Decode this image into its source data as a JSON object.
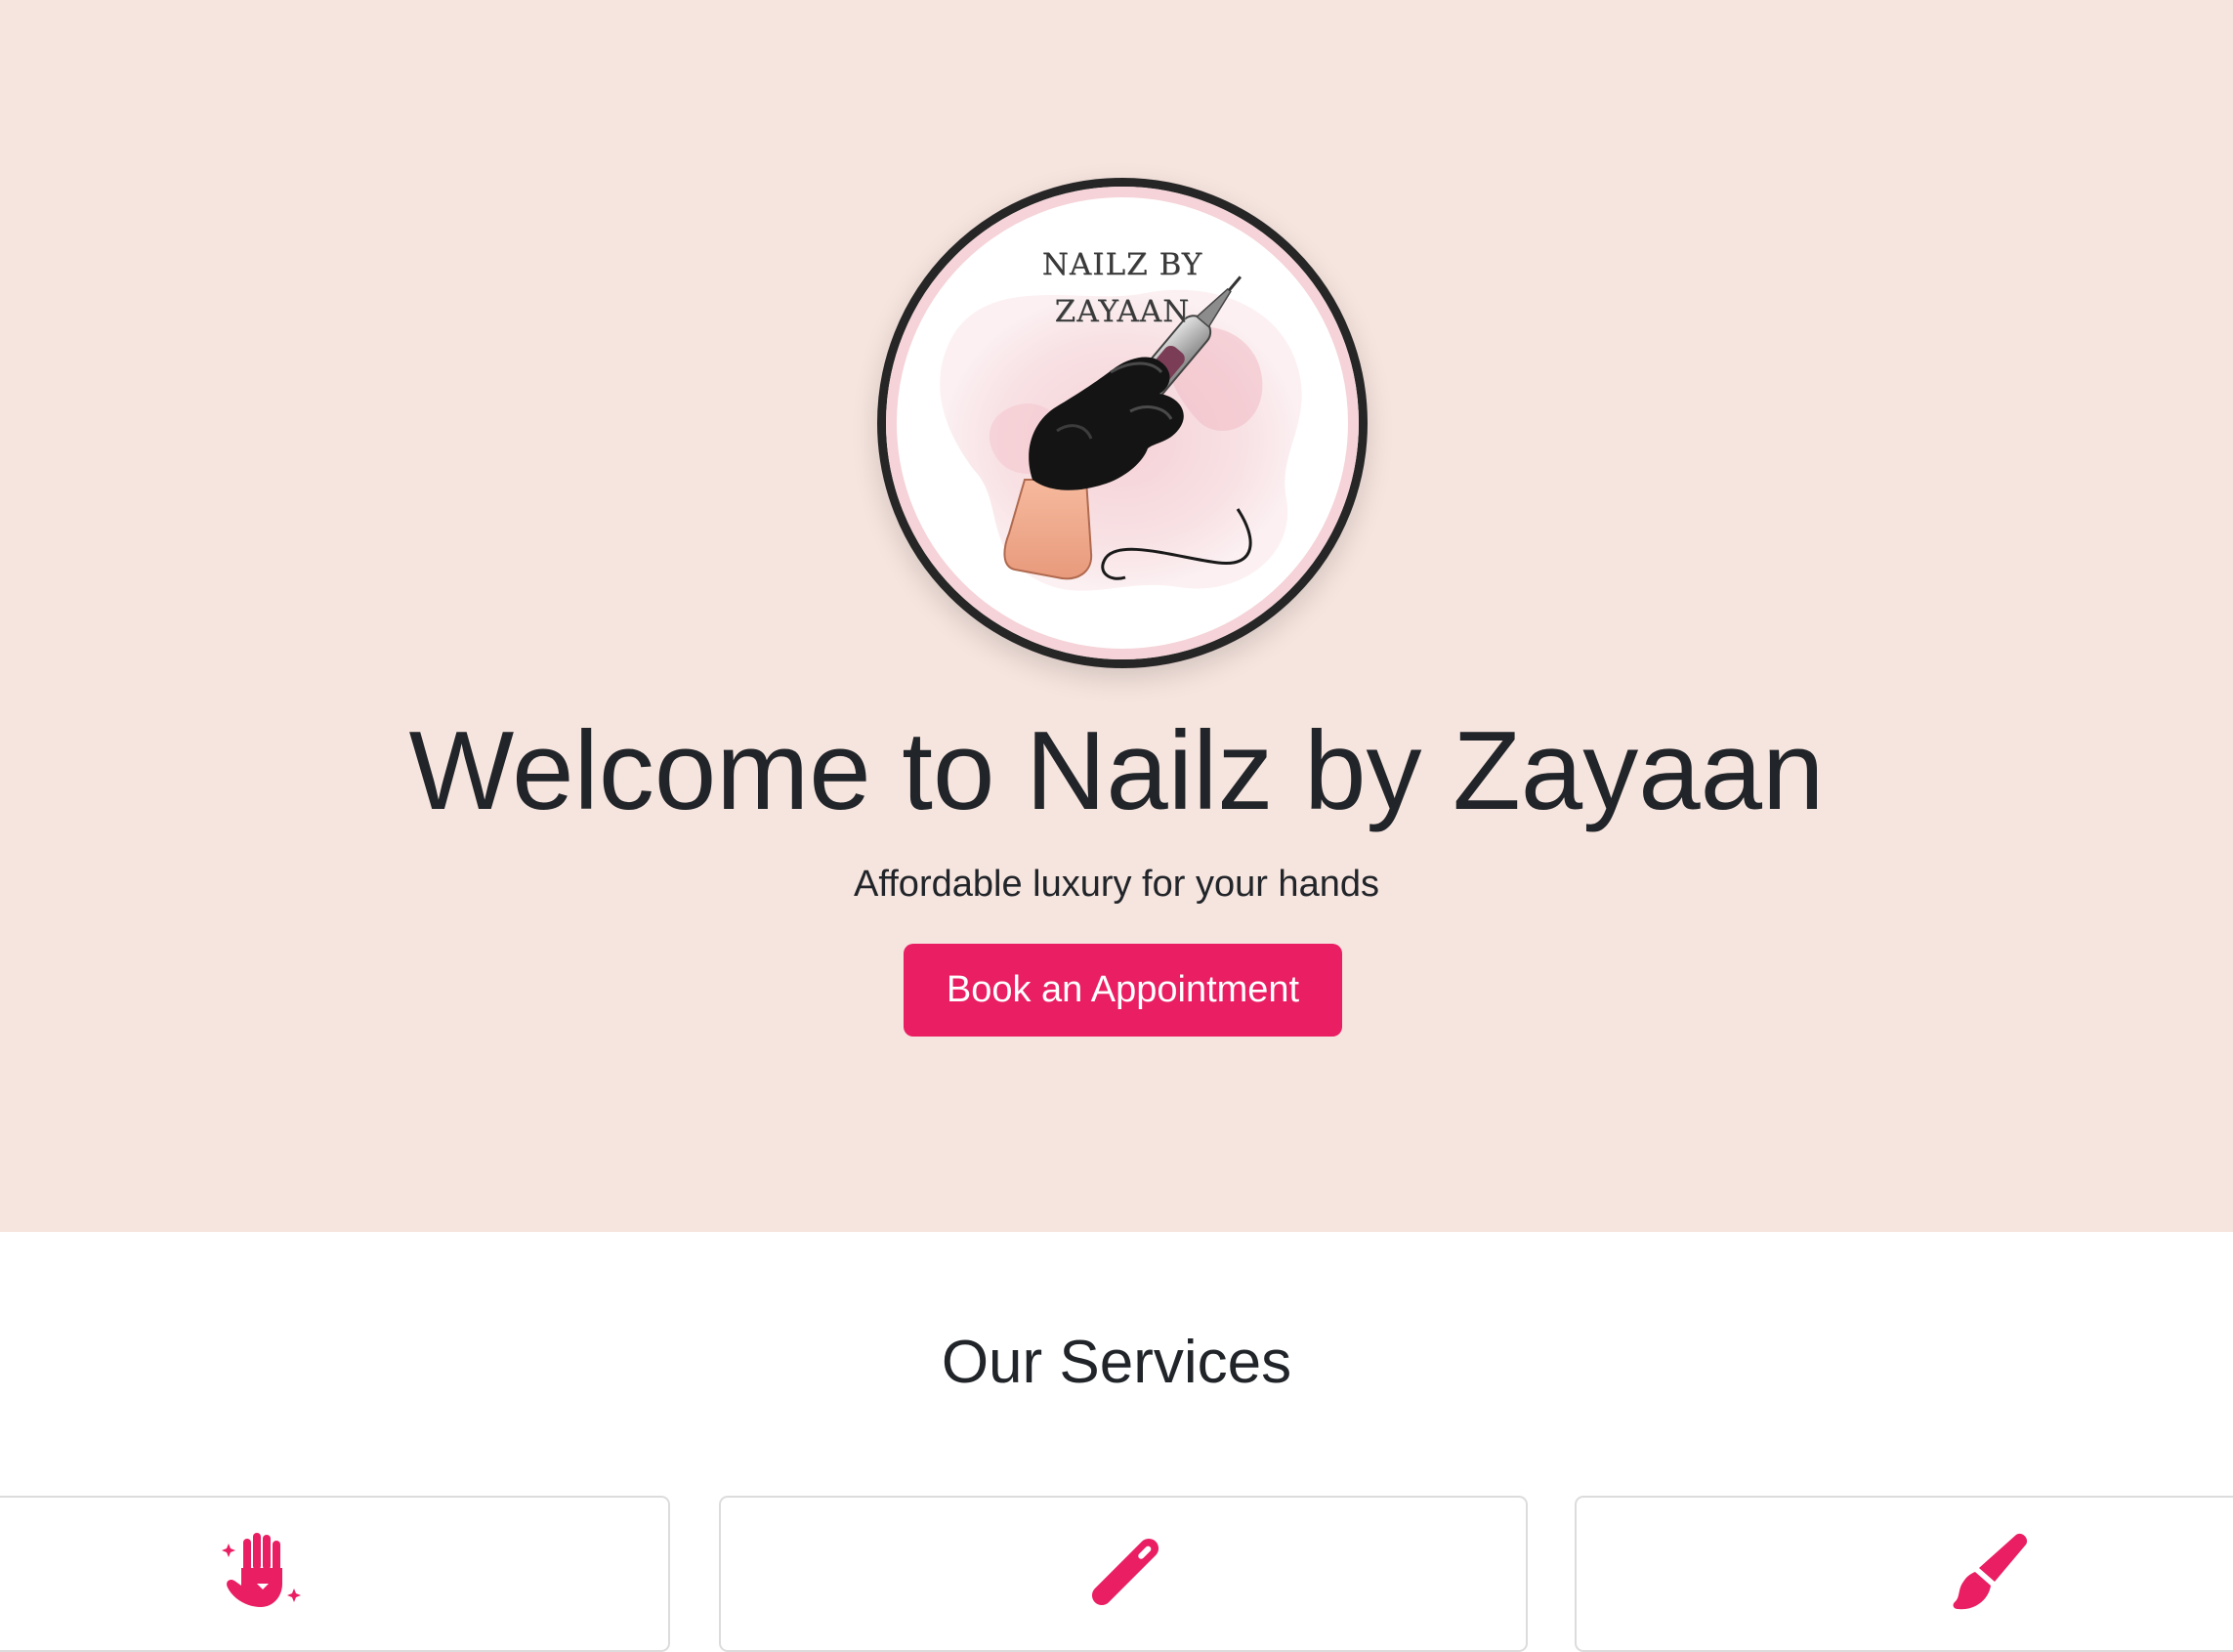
{
  "hero": {
    "logo_line1": "NAILZ BY",
    "logo_line2": "ZAYAAN",
    "title": "Welcome to Nailz by Zayaan",
    "subtitle": "Affordable luxury for your hands",
    "cta_label": "Book an Appointment"
  },
  "services": {
    "title": "Our Services",
    "cards": [
      {
        "icon": "hand-sparkles-icon"
      },
      {
        "icon": "nail-file-icon"
      },
      {
        "icon": "paint-brush-icon"
      }
    ]
  },
  "colors": {
    "hero_background": "#f6e4de",
    "accent": "#e91e63",
    "text": "#212529"
  }
}
